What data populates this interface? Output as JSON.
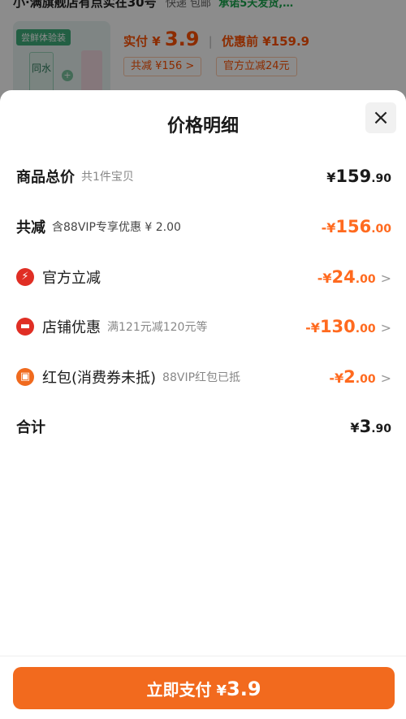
{
  "background": {
    "top_line": "小·满旗舰店有点实在30号",
    "shipping": "快递 包邮",
    "promise": "承诺5天发货,…",
    "product_tag": "尝鲜体验装",
    "product_box_text": "同水",
    "price_prefix": "实付",
    "price_yen": "¥",
    "price_value": "3.9",
    "price_before": "优惠前 ¥159.9",
    "chip_total_reduce": "共减 ¥156 >",
    "chip_official": "官方立减24元"
  },
  "sheet": {
    "title": "价格明细",
    "close_icon": "close-icon",
    "rows": [
      {
        "label": "商品总价",
        "sub": "共1件宝贝",
        "yen": "¥",
        "int": "159",
        "dec": ".90"
      },
      {
        "label": "共减",
        "sub": "含88VIP专享优惠 ¥ 2.00",
        "yen": "-¥",
        "int": "156",
        "dec": ".00"
      },
      {
        "label": "官方立减",
        "icon": "lightning-icon",
        "yen": "-¥",
        "int": "24",
        "dec": ".00"
      },
      {
        "label": "店铺优惠",
        "sub": "满121元减120元等",
        "icon": "shop-icon",
        "yen": "-¥",
        "int": "130",
        "dec": ".00"
      },
      {
        "label": "红包(消费券未抵)",
        "sub": "88VIP红包已抵",
        "icon": "red-packet-icon",
        "yen": "-¥",
        "int": "2",
        "dec": ".00"
      },
      {
        "label": "合计",
        "yen": "¥",
        "int": "3",
        "dec": ".90"
      }
    ],
    "chevron": ">"
  },
  "pay_button": {
    "label": "立即支付",
    "yen": "¥",
    "value": "3.9"
  },
  "colors": {
    "accent_orange": "#f26a1e",
    "discount_orange": "#ff6a1f",
    "icon_red": "#e02e24"
  }
}
